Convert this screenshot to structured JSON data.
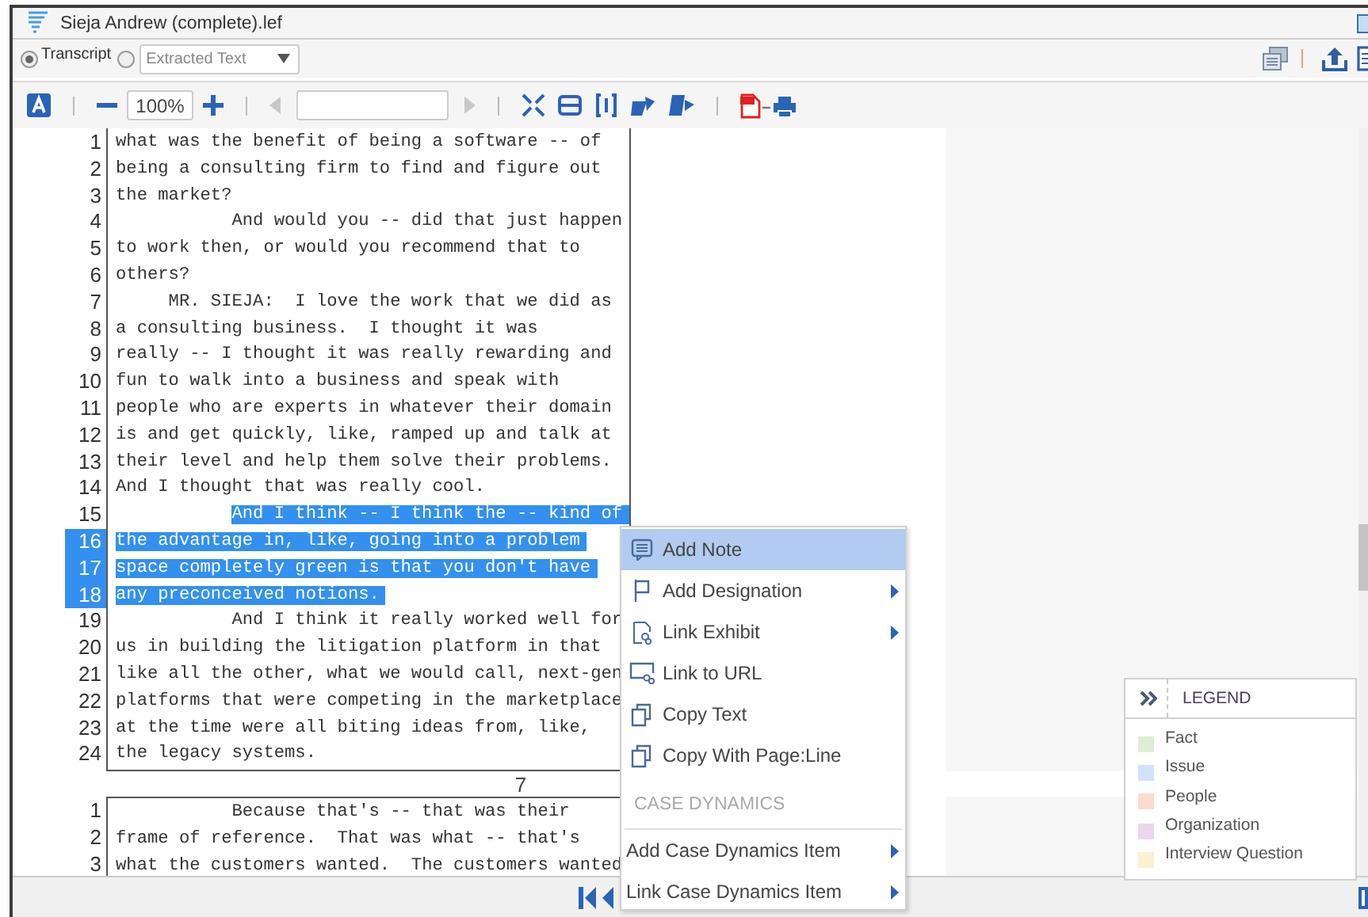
{
  "window": {
    "title": "Sieja Andrew (complete).lef"
  },
  "view_mode": {
    "label": "Transcript",
    "selected": true
  },
  "source_mode": {
    "selected": false,
    "dropdown": "Extracted Text"
  },
  "toolbar": {
    "zoom": "100%"
  },
  "pages": [
    {
      "page_number": "7",
      "lines": [
        {
          "number": "1",
          "text": "what was the benefit of being a software -- of",
          "selected": false
        },
        {
          "number": "2",
          "text": "being a consulting firm to find and figure out",
          "selected": false
        },
        {
          "number": "3",
          "text": "the market?",
          "selected": false
        },
        {
          "number": "4",
          "text": "           And would you -- did that just happen",
          "selected": false
        },
        {
          "number": "5",
          "text": "to work then, or would you recommend that to",
          "selected": false
        },
        {
          "number": "6",
          "text": "others?",
          "selected": false
        },
        {
          "number": "7",
          "text": "     MR. SIEJA:  I love the work that we did as",
          "selected": false
        },
        {
          "number": "8",
          "text": "a consulting business.  I thought it was",
          "selected": false
        },
        {
          "number": "9",
          "text": "really -- I thought it was really rewarding and",
          "selected": false
        },
        {
          "number": "10",
          "text": "fun to walk into a business and speak with",
          "selected": false
        },
        {
          "number": "11",
          "text": "people who are experts in whatever their domain",
          "selected": false
        },
        {
          "number": "12",
          "text": "is and get quickly, like, ramped up and talk at",
          "selected": false
        },
        {
          "number": "13",
          "text": "their level and help them solve their problems.",
          "selected": false
        },
        {
          "number": "14",
          "text": "And I thought that was really cool.",
          "selected": false
        },
        {
          "number": "15",
          "text": "           And I think -- I think the -- kind of",
          "selected": true
        },
        {
          "number": "16",
          "text": "the advantage in, like, going into a problem",
          "selected": true
        },
        {
          "number": "17",
          "text": "space completely green is that you don't have",
          "selected": true
        },
        {
          "number": "18",
          "text": "any preconceived notions.",
          "selected": true
        },
        {
          "number": "19",
          "text": "           And I think it really worked well for",
          "selected": false
        },
        {
          "number": "20",
          "text": "us in building the litigation platform in that",
          "selected": false
        },
        {
          "number": "21",
          "text": "like all the other, what we would call, next-gen",
          "selected": false
        },
        {
          "number": "22",
          "text": "platforms that were competing in the marketplace",
          "selected": false
        },
        {
          "number": "23",
          "text": "at the time were all biting ideas from, like,",
          "selected": false
        },
        {
          "number": "24",
          "text": "the legacy systems.",
          "selected": false
        }
      ]
    },
    {
      "lines": [
        {
          "number": "1",
          "text": "           Because that's -- that was their",
          "selected": false
        },
        {
          "number": "2",
          "text": "frame of reference.  That was what -- that's",
          "selected": false
        },
        {
          "number": "3",
          "text": "what the customers wanted.  The customers wanted",
          "selected": false
        }
      ]
    }
  ],
  "context_menu": {
    "items": [
      {
        "kind": "item",
        "label": "Add Note",
        "selected": true,
        "submenu": false
      },
      {
        "kind": "item",
        "label": "Add Designation",
        "selected": false,
        "submenu": true
      },
      {
        "kind": "item",
        "label": "Link Exhibit",
        "selected": false,
        "submenu": true
      },
      {
        "kind": "item",
        "label": "Link to URL",
        "selected": false,
        "submenu": false
      },
      {
        "kind": "item",
        "label": "Copy Text",
        "selected": false,
        "submenu": false
      },
      {
        "kind": "item",
        "label": "Copy With Page:Line",
        "selected": false,
        "submenu": false
      },
      {
        "kind": "header",
        "label": "CASE DYNAMICS"
      },
      {
        "kind": "plain",
        "label": "Add Case Dynamics Item",
        "selected": false,
        "submenu": true
      },
      {
        "kind": "plain",
        "label": "Link Case Dynamics Item",
        "selected": false,
        "submenu": true
      }
    ]
  },
  "legend": {
    "title": "LEGEND",
    "items": [
      {
        "label": "Fact",
        "color": "#dcefd6"
      },
      {
        "label": "Issue",
        "color": "#cfe3fb"
      },
      {
        "label": "People",
        "color": "#fbdccd"
      },
      {
        "label": "Organization",
        "color": "#ead7ee"
      },
      {
        "label": "Interview Question",
        "color": "#fdefd0"
      }
    ]
  }
}
